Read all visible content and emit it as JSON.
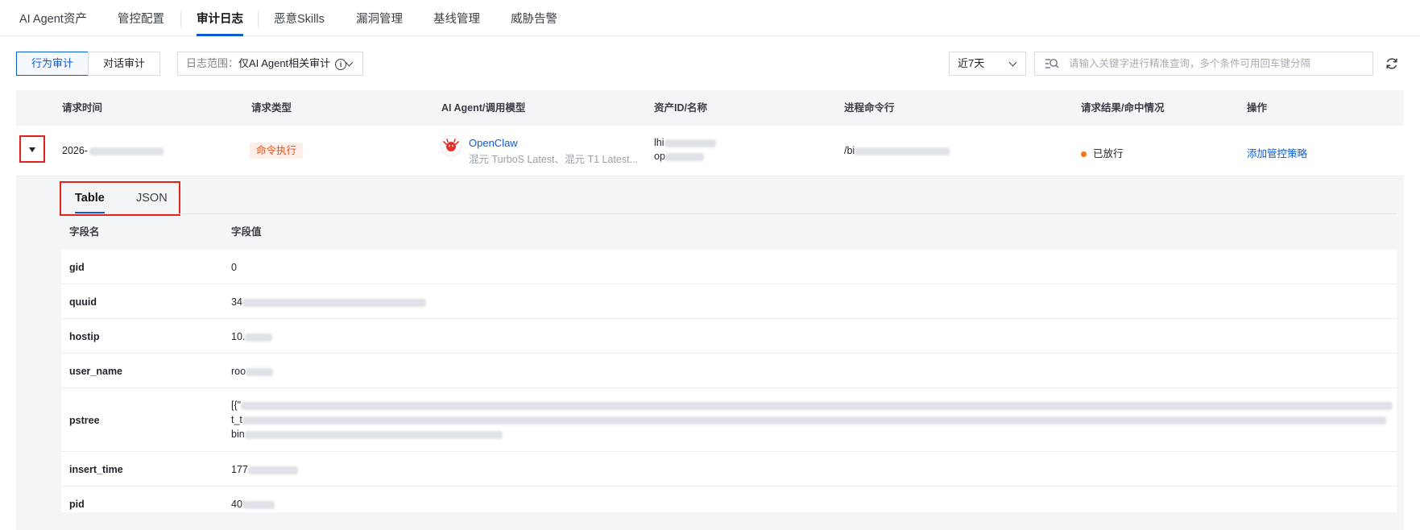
{
  "nav": {
    "tabs": [
      {
        "label": "AI Agent资产"
      },
      {
        "label": "管控配置"
      },
      {
        "label": "审计日志",
        "active": true
      },
      {
        "label": "恶意Skills"
      },
      {
        "label": "漏洞管理"
      },
      {
        "label": "基线管理"
      },
      {
        "label": "威胁告警"
      }
    ]
  },
  "toolbar": {
    "behavior_audit": "行为审计",
    "dialog_audit": "对话审计",
    "scope_label": "日志范围：",
    "scope_value": "仅AI Agent相关审计",
    "range_value": "近7天",
    "search_placeholder": "请输入关键字进行精准查询，多个条件可用回车键分隔"
  },
  "table": {
    "headers": [
      "请求时间",
      "请求类型",
      "AI Agent/调用模型",
      "资产ID/名称",
      "进程命令行",
      "请求结果/命中情况",
      "操作"
    ],
    "row": {
      "time": "2026-",
      "type": "命令执行",
      "agent_name": "OpenClaw",
      "agent_models": "混元 TurboS Latest、混元 T1 Latest...",
      "asset_id": "lhi",
      "asset_name": "op",
      "cmdline": "/bi",
      "result": "已放行",
      "action": "添加管控策略"
    }
  },
  "detail": {
    "tabs": [
      "Table",
      "JSON"
    ],
    "headers": [
      "字段名",
      "字段值"
    ],
    "fields": [
      {
        "name": "gid",
        "value": "0"
      },
      {
        "name": "quuid",
        "value": "34"
      },
      {
        "name": "hostip",
        "value": "10."
      },
      {
        "name": "user_name",
        "value": "roo"
      },
      {
        "name": "pstree",
        "value": "[{\"",
        "value2": "t_t",
        "value3": "bin"
      },
      {
        "name": "insert_time",
        "value": "177"
      },
      {
        "name": "pid",
        "value": "40"
      }
    ]
  },
  "colors": {
    "accent": "#0b5bd3",
    "highlight_box": "#e0231c",
    "tag_text": "#e0531c",
    "tag_bg": "#fdeee8",
    "status_dot": "#f0761a"
  }
}
